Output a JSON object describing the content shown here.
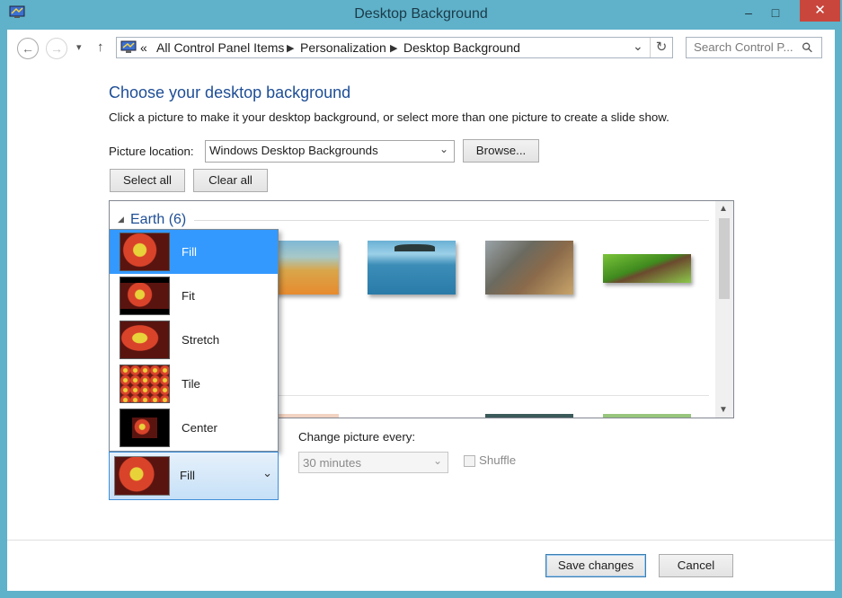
{
  "window": {
    "title": "Desktop Background",
    "minimize": "–",
    "maximize": "□",
    "close": "✕"
  },
  "nav": {
    "back": "←",
    "forward": "→",
    "recent": "▾",
    "up": "↑",
    "overflow": "«",
    "breadcrumbs": [
      "All Control Panel Items",
      "Personalization",
      "Desktop Background"
    ],
    "dropdown": "⌄",
    "refresh": "↻",
    "search_placeholder": "Search Control P...",
    "search_icon": "⚲"
  },
  "content": {
    "heading": "Choose your desktop background",
    "subtitle": "Click a picture to make it your desktop background, or select more than one picture to create a slide show.",
    "location_label": "Picture location:",
    "location_value": "Windows Desktop Backgrounds",
    "browse_label": "Browse...",
    "select_all_label": "Select all",
    "clear_all_label": "Clear all",
    "group": {
      "collapse_icon": "◢",
      "label": "Earth (6)"
    }
  },
  "position_menu": {
    "options": [
      "Fill",
      "Fit",
      "Stretch",
      "Tile",
      "Center"
    ],
    "selected": "Fill"
  },
  "slideshow": {
    "change_label": "Change picture every:",
    "interval_value": "30 minutes",
    "shuffle_label": "Shuffle"
  },
  "footer": {
    "save_label": "Save changes",
    "cancel_label": "Cancel"
  },
  "colors": {
    "accent": "#3399ff",
    "heading": "#1e4e96",
    "titlebar": "#5fb2c9",
    "close": "#c9463d"
  }
}
